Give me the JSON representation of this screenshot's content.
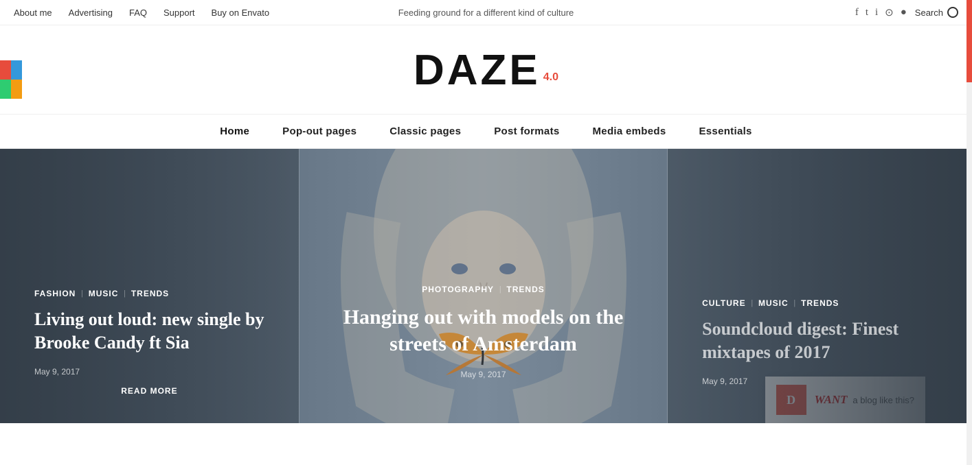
{
  "topbar": {
    "links": [
      "About me",
      "Advertising",
      "FAQ",
      "Support",
      "Buy on Envato"
    ],
    "tagline": "Feeding ground for a different kind of culture",
    "search_label": "Search",
    "social_icons": [
      "facebook",
      "twitter",
      "instagram",
      "dribbble",
      "circle"
    ]
  },
  "logo": {
    "text": "DAZE",
    "version": "4.0"
  },
  "nav": {
    "items": [
      "Home",
      "Pop-out pages",
      "Classic pages",
      "Post formats",
      "Media embeds",
      "Essentials"
    ]
  },
  "hero": {
    "slides": [
      {
        "categories": [
          "Fashion",
          "Music",
          "Trends"
        ],
        "title": "Living out loud: new single by Brooke Candy ft Sia",
        "date": "May 9, 2017",
        "read_more": "Read more",
        "position": "left"
      },
      {
        "categories": [
          "Photography",
          "Trends"
        ],
        "title": "Hanging out with models on the streets of Amsterdam",
        "date": "May 9, 2017",
        "position": "center"
      },
      {
        "categories": [
          "Culture",
          "Music",
          "Trends"
        ],
        "title": "Soundcloud digest: Finest mixtapes of 2017",
        "date": "May 9, 2017",
        "position": "right"
      }
    ]
  },
  "promo": {
    "icon_text": "D",
    "text_prefix": "WANT",
    "text_suffix": "a blog like this?"
  },
  "colors": {
    "accent": "#e74c3c",
    "dark": "#111111",
    "nav_text": "#222222"
  }
}
